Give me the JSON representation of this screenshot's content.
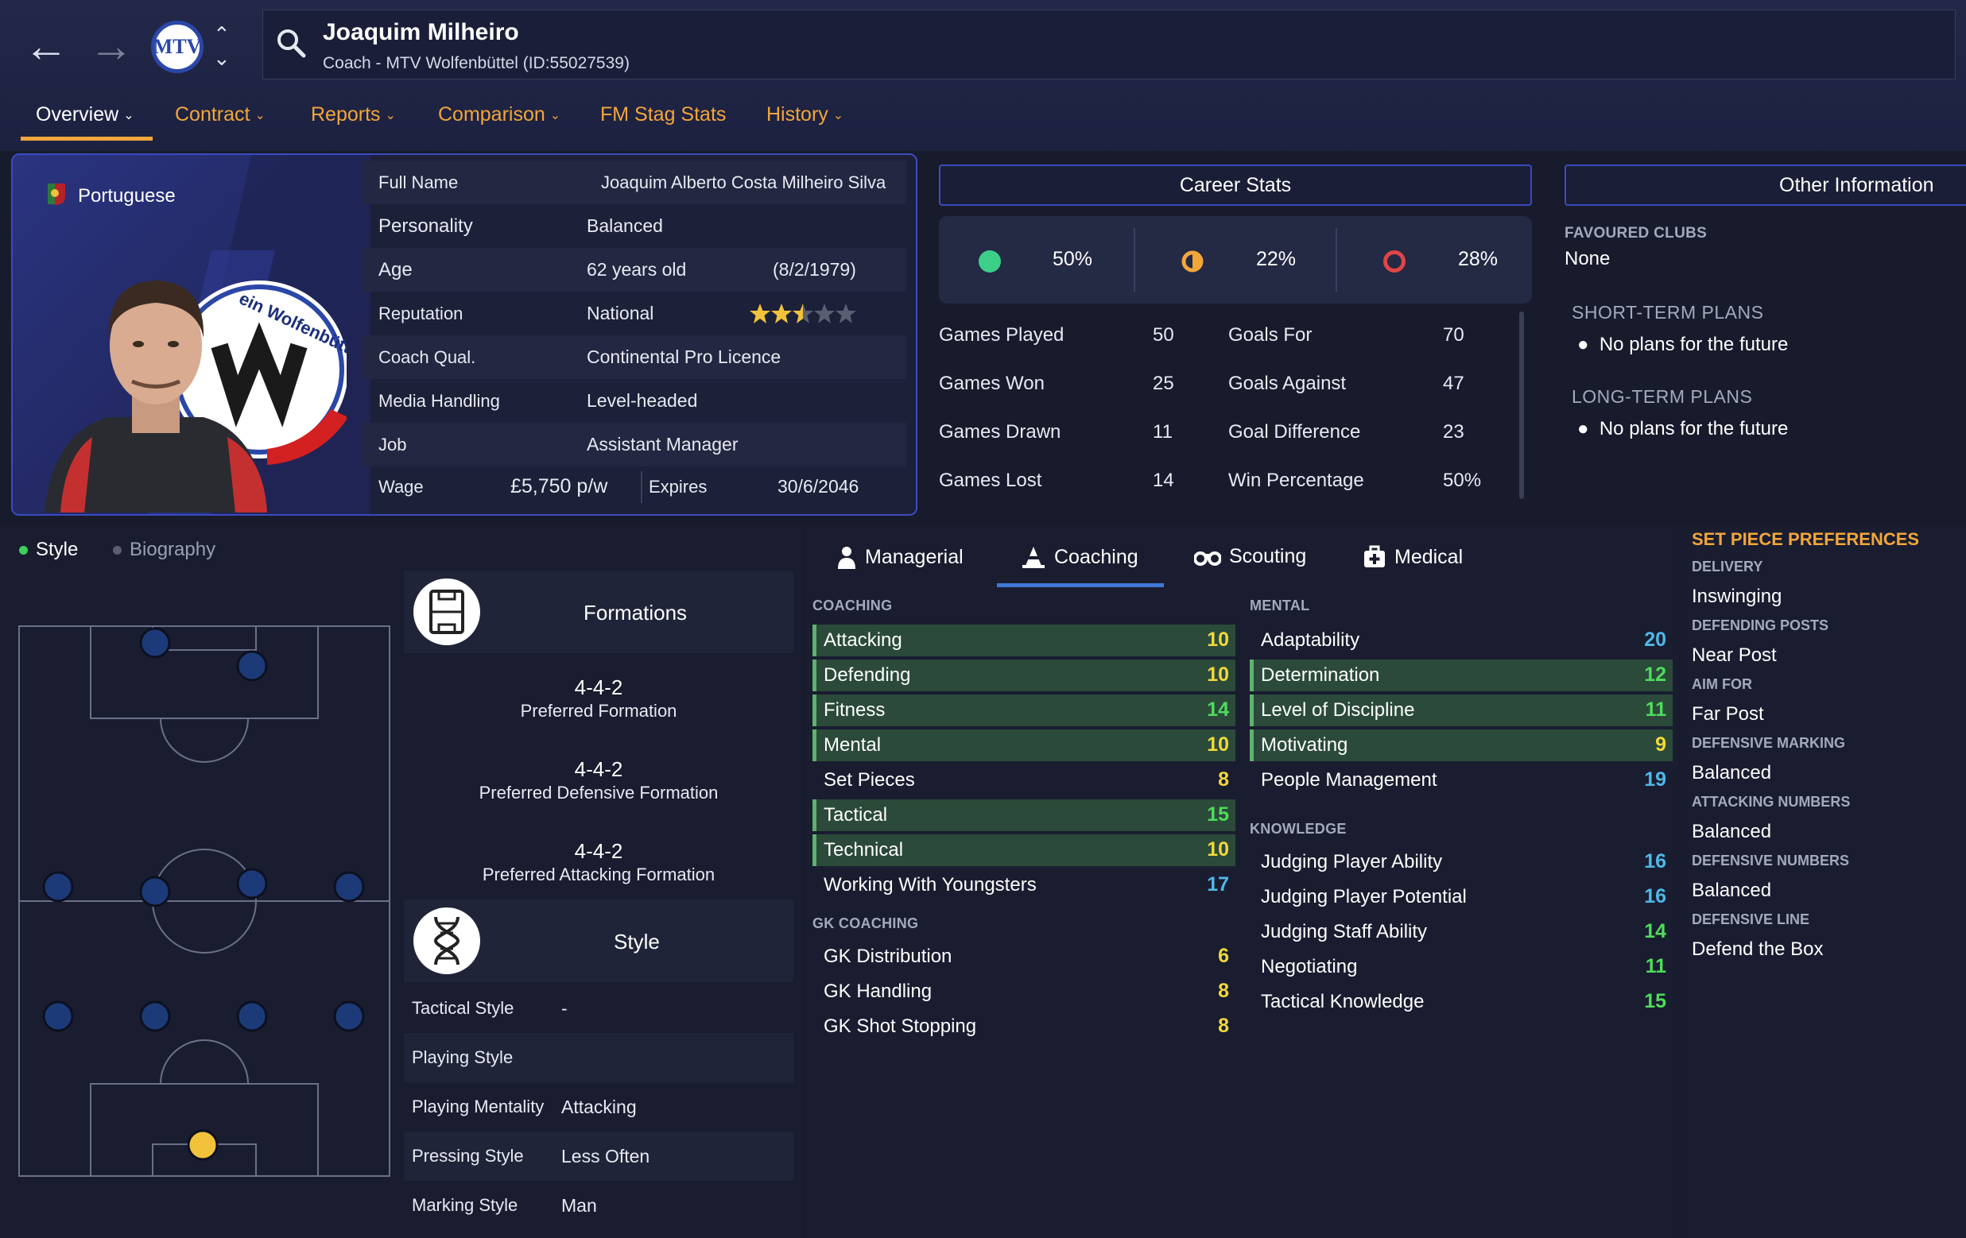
{
  "header": {
    "name": "Joaquim Milheiro",
    "subtitle": "Coach - MTV Wolfenbüttel (ID:55027539)",
    "crest_text": "MTV"
  },
  "tabs": [
    {
      "label": "Overview",
      "active": true,
      "has_menu": true
    },
    {
      "label": "Contract",
      "active": false,
      "has_menu": true
    },
    {
      "label": "Reports",
      "active": false,
      "has_menu": true
    },
    {
      "label": "Comparison",
      "active": false,
      "has_menu": true
    },
    {
      "label": "FM Stag Stats",
      "active": false,
      "has_menu": false
    },
    {
      "label": "History",
      "active": false,
      "has_menu": true
    }
  ],
  "profile": {
    "nationality": "Portuguese",
    "crest_text": "ein Wolfenbüttel e.V.",
    "full_name_label": "Full Name",
    "full_name": "Joaquim Alberto Costa Milheiro Silva",
    "personality_label": "Personality",
    "personality": "Balanced",
    "age_label": "Age",
    "age": "62 years old",
    "dob": "(8/2/1979)",
    "reputation_label": "Reputation",
    "reputation": "National",
    "reputation_stars": 2.5,
    "coach_qual_label": "Coach Qual.",
    "coach_qual": "Continental Pro Licence",
    "media_label": "Media Handling",
    "media": "Level-headed",
    "job_label": "Job",
    "job": "Assistant Manager",
    "wage_label": "Wage",
    "wage": "£5,750 p/w",
    "expires_label": "Expires",
    "expires": "30/6/2046"
  },
  "career": {
    "title": "Career Stats",
    "win_pct": "50%",
    "draw_pct": "22%",
    "loss_pct": "28%",
    "left": [
      {
        "label": "Games Played",
        "value": "50"
      },
      {
        "label": "Games Won",
        "value": "25"
      },
      {
        "label": "Games Drawn",
        "value": "11"
      },
      {
        "label": "Games Lost",
        "value": "14"
      }
    ],
    "right": [
      {
        "label": "Goals For",
        "value": "70"
      },
      {
        "label": "Goals Against",
        "value": "47"
      },
      {
        "label": "Goal Difference",
        "value": "23"
      },
      {
        "label": "Win Percentage",
        "value": "50%"
      }
    ]
  },
  "other": {
    "title": "Other Information",
    "fav_label": "FAVOURED CLUBS",
    "fav_value": "None",
    "short_label": "SHORT-TERM PLANS",
    "short_value": "No plans for the future",
    "long_label": "LONG-TERM PLANS",
    "long_value": "No plans for the future"
  },
  "lower": {
    "style_toggle": "Style",
    "bio_toggle": "Biography"
  },
  "formations": {
    "title": "Formations",
    "preferred": "4-4-2",
    "preferred_label": "Preferred Formation",
    "defensive": "4-4-2",
    "defensive_label": "Preferred Defensive Formation",
    "attacking": "4-4-2",
    "attacking_label": "Preferred Attacking Formation"
  },
  "style": {
    "title": "Style",
    "rows": [
      {
        "label": "Tactical Style",
        "value": "-"
      },
      {
        "label": "Playing Style",
        "value": ""
      },
      {
        "label": "Playing Mentality",
        "value": "Attacking"
      },
      {
        "label": "Pressing Style",
        "value": "Less Often"
      },
      {
        "label": "Marking Style",
        "value": "Man"
      }
    ]
  },
  "attr_tabs": [
    {
      "label": "Managerial",
      "icon": "person-icon"
    },
    {
      "label": "Coaching",
      "icon": "cone-icon"
    },
    {
      "label": "Scouting",
      "icon": "binoculars-icon"
    },
    {
      "label": "Medical",
      "icon": "medical-kit-icon"
    }
  ],
  "coaching": {
    "label": "COACHING",
    "attrs": [
      {
        "name": "Attacking",
        "value": "10",
        "hl": true
      },
      {
        "name": "Defending",
        "value": "10",
        "hl": true
      },
      {
        "name": "Fitness",
        "value": "14",
        "hl": true
      },
      {
        "name": "Mental",
        "value": "10",
        "hl": true
      },
      {
        "name": "Set Pieces",
        "value": "8",
        "hl": false
      },
      {
        "name": "Tactical",
        "value": "15",
        "hl": true
      },
      {
        "name": "Technical",
        "value": "10",
        "hl": true
      },
      {
        "name": "Working With Youngsters",
        "value": "17",
        "hl": false
      }
    ]
  },
  "gk": {
    "label": "GK COACHING",
    "attrs": [
      {
        "name": "GK Distribution",
        "value": "6",
        "hl": false
      },
      {
        "name": "GK Handling",
        "value": "8",
        "hl": false
      },
      {
        "name": "GK Shot Stopping",
        "value": "8",
        "hl": false
      }
    ]
  },
  "mental": {
    "label": "MENTAL",
    "attrs": [
      {
        "name": "Adaptability",
        "value": "20",
        "hl": false
      },
      {
        "name": "Determination",
        "value": "12",
        "hl": true
      },
      {
        "name": "Level of Discipline",
        "value": "11",
        "hl": true
      },
      {
        "name": "Motivating",
        "value": "9",
        "hl": true
      },
      {
        "name": "People Management",
        "value": "19",
        "hl": false
      }
    ]
  },
  "knowledge": {
    "label": "KNOWLEDGE",
    "attrs": [
      {
        "name": "Judging Player Ability",
        "value": "16",
        "hl": false
      },
      {
        "name": "Judging Player Potential",
        "value": "16",
        "hl": false
      },
      {
        "name": "Judging Staff Ability",
        "value": "14",
        "hl": false
      },
      {
        "name": "Negotiating",
        "value": "11",
        "hl": false
      },
      {
        "name": "Tactical Knowledge",
        "value": "15",
        "hl": false
      }
    ]
  },
  "setpiece": {
    "title": "SET PIECE PREFERENCES",
    "items": [
      {
        "label": "DELIVERY",
        "value": "Inswinging"
      },
      {
        "label": "DEFENDING POSTS",
        "value": "Near Post"
      },
      {
        "label": "AIM FOR",
        "value": "Far Post"
      },
      {
        "label": "DEFENSIVE MARKING",
        "value": "Balanced"
      },
      {
        "label": "ATTACKING NUMBERS",
        "value": "Balanced"
      },
      {
        "label": "DEFENSIVE NUMBERS",
        "value": "Balanced"
      },
      {
        "label": "DEFENSIVE LINE",
        "value": "Defend the Box"
      }
    ]
  },
  "colors": {
    "accent": "#f2a63a",
    "panel_border": "#3b4bc0",
    "attr_high": "#4fdc5a",
    "attr_mid": "#f2d83a",
    "attr_top": "#4fb8e8",
    "win": "#3ccf88",
    "draw": "#f2a63a",
    "loss": "#e04545"
  }
}
